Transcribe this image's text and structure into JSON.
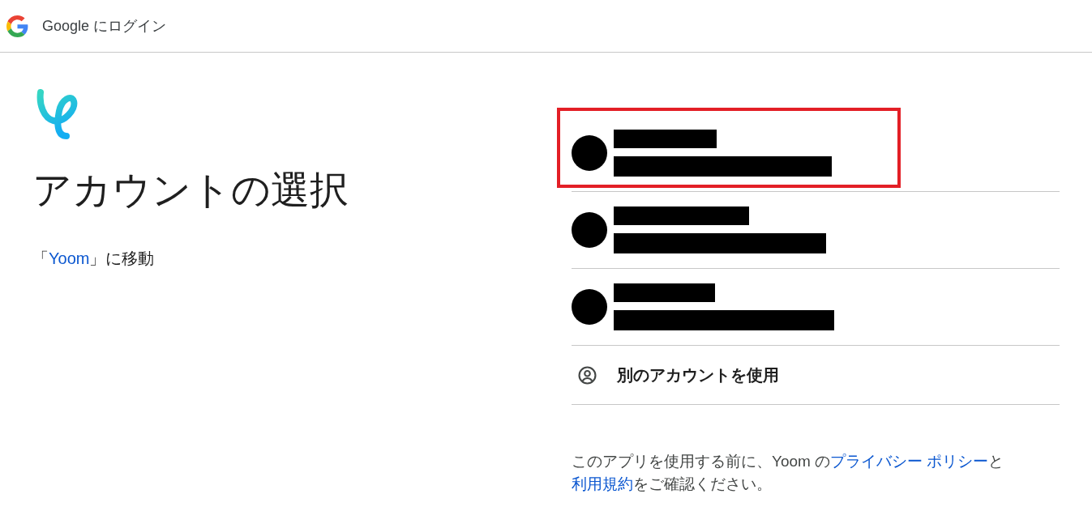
{
  "header": {
    "title": "Google にログイン"
  },
  "intro": {
    "heading": "アカウントの選択",
    "destination": [
      {
        "kind": "text",
        "text": "「"
      },
      {
        "kind": "link",
        "text": "Yoom"
      },
      {
        "kind": "text",
        "text": "」に移動"
      }
    ]
  },
  "accounts": [
    {
      "highlighted": true
    },
    {
      "highlighted": false
    },
    {
      "highlighted": false
    }
  ],
  "other_account": {
    "label": "別のアカウントを使用"
  },
  "notice": [
    {
      "kind": "text",
      "text": "このアプリを使用する前に、Yoom の"
    },
    {
      "kind": "link",
      "text": "プライバシー ポリシー"
    },
    {
      "kind": "text",
      "text": "と"
    },
    {
      "kind": "link",
      "text": "利用規約"
    },
    {
      "kind": "text",
      "text": "をご確認ください。"
    }
  ]
}
